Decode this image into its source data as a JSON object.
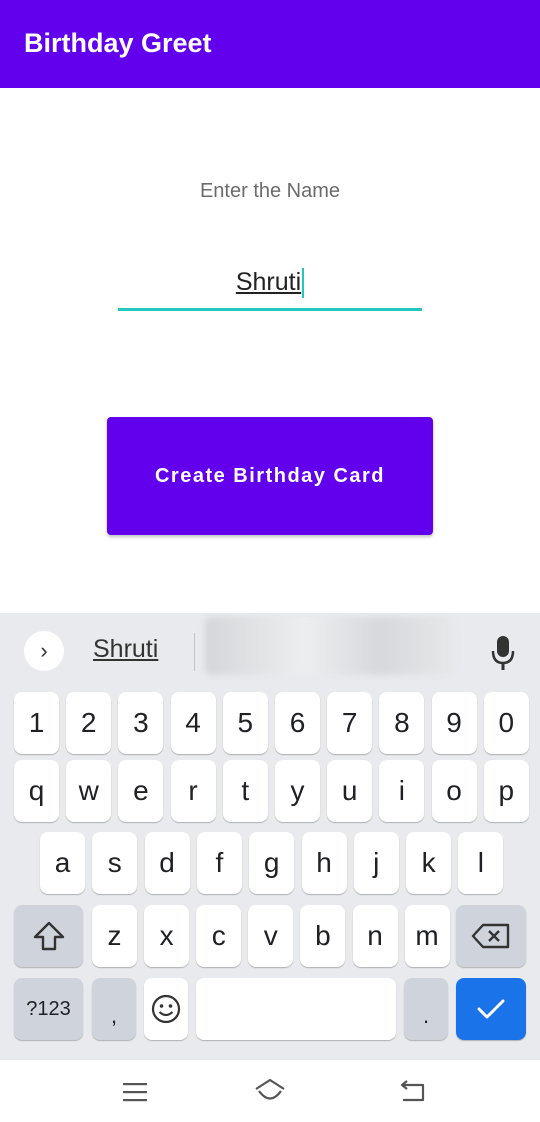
{
  "app_bar": {
    "title": "Birthday Greet"
  },
  "form": {
    "label": "Enter the Name",
    "name_value": "Shruti",
    "button_label": "Create Birthday Card"
  },
  "keyboard": {
    "suggestion": "Shruti",
    "row_numbers": [
      "1",
      "2",
      "3",
      "4",
      "5",
      "6",
      "7",
      "8",
      "9",
      "0"
    ],
    "row_1": [
      "q",
      "w",
      "e",
      "r",
      "t",
      "y",
      "u",
      "i",
      "o",
      "p"
    ],
    "row_2": [
      "a",
      "s",
      "d",
      "f",
      "g",
      "h",
      "j",
      "k",
      "l"
    ],
    "row_3": [
      "z",
      "x",
      "c",
      "v",
      "b",
      "n",
      "m"
    ],
    "symbols_key": "?123",
    "comma_key": ",",
    "period_key": "."
  },
  "colors": {
    "primary": "#6200ee",
    "accent": "#22c7c1",
    "enter": "#1a73e8"
  }
}
